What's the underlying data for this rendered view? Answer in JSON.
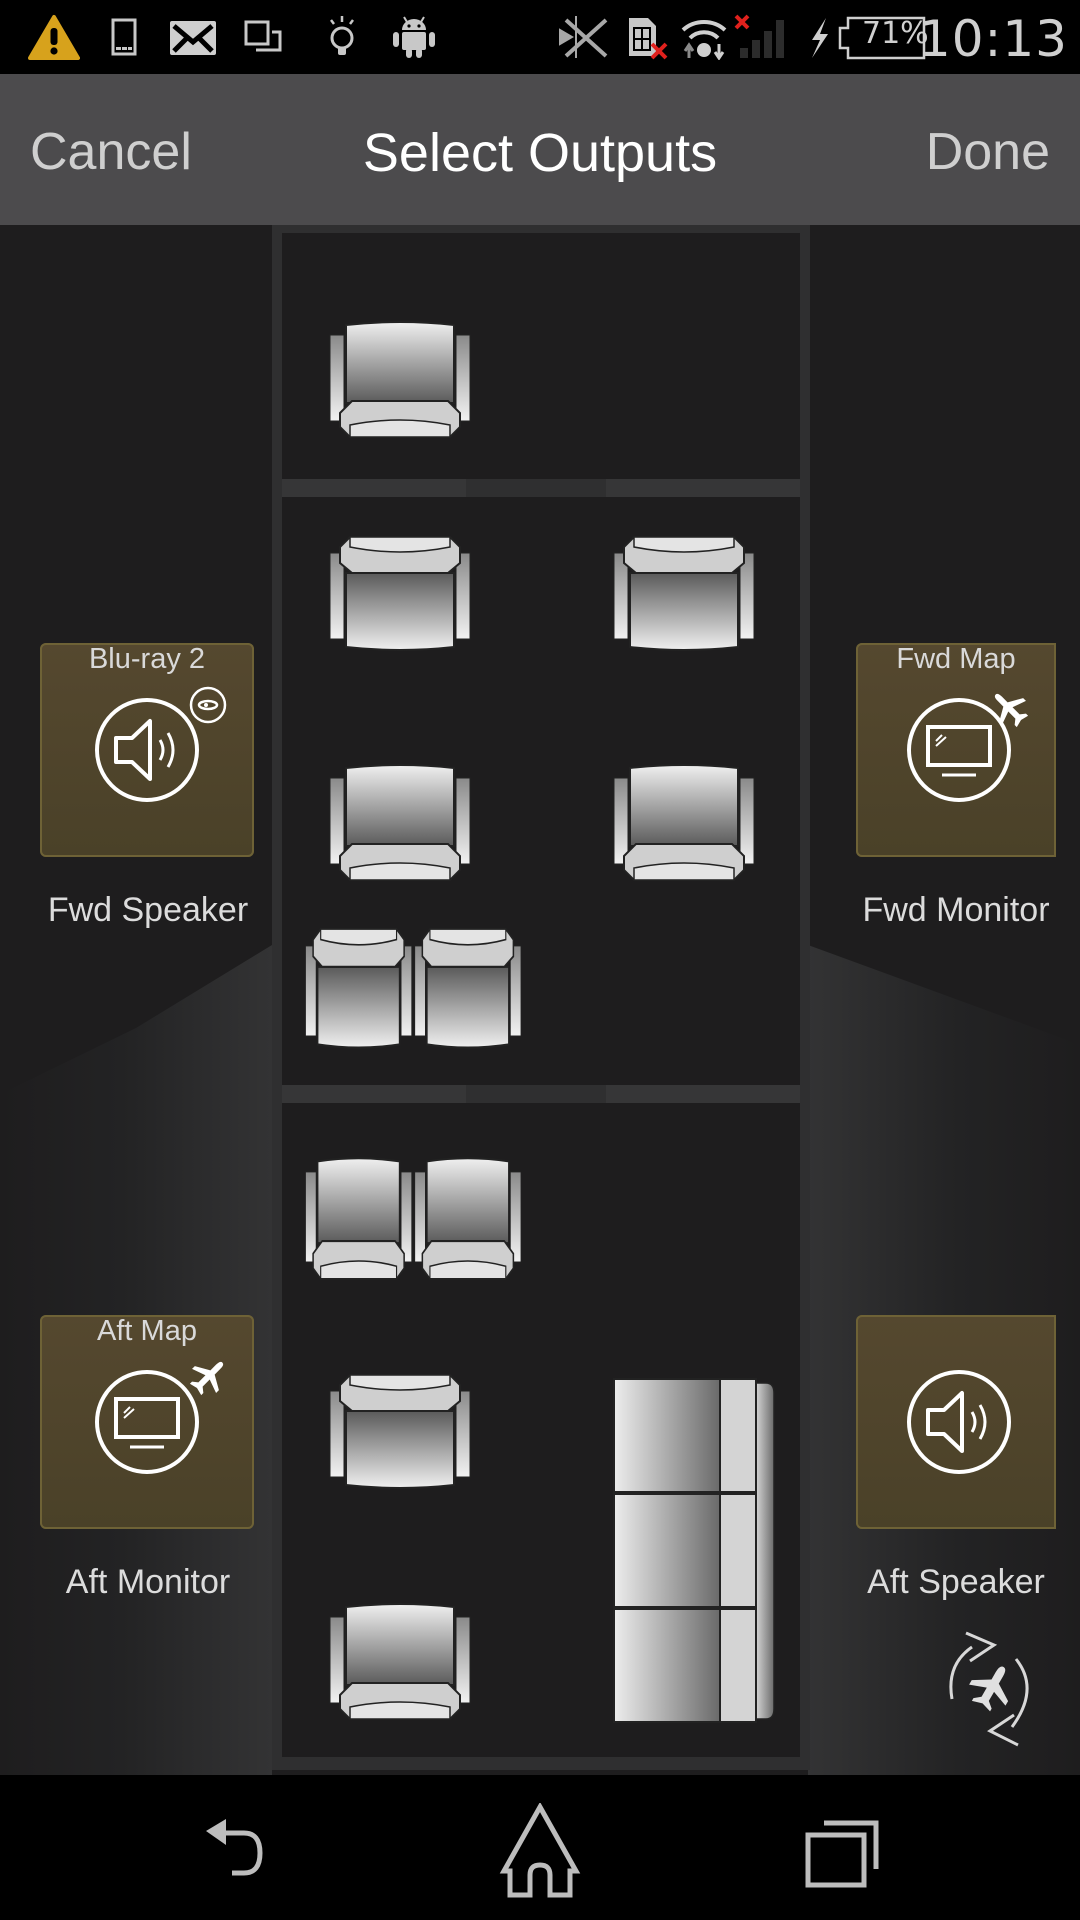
{
  "status_bar": {
    "left_icons": [
      "warning-icon",
      "phone-icon",
      "email-icon",
      "screen-mirror-icon",
      "lightbulb-icon",
      "android-icon"
    ],
    "right_icons": [
      "bluetooth-off-icon",
      "sim-missing-icon",
      "wifi-icon",
      "signal-no-service-icon",
      "charging-icon",
      "battery-icon"
    ],
    "battery": "71%",
    "time": "10:13",
    "colors": {
      "warning": "#d7a21c",
      "error_x": "#e0211d"
    }
  },
  "action_bar": {
    "cancel_label": "Cancel",
    "title": "Select Outputs",
    "done_label": "Done"
  },
  "outputs": [
    {
      "id": "fwd-speaker",
      "label": "Fwd Speaker",
      "source": "Blu-ray 2",
      "icon": "speaker-icon",
      "badge": "bluray-icon",
      "side": "left",
      "position": "forward"
    },
    {
      "id": "fwd-monitor",
      "label": "Fwd Monitor",
      "source": "Fwd Map",
      "icon": "monitor-icon",
      "badge": "airplane-icon",
      "side": "right",
      "position": "forward"
    },
    {
      "id": "aft-monitor",
      "label": "Aft Monitor",
      "source": "Aft Map",
      "icon": "monitor-icon",
      "badge": "airplane-icon",
      "side": "left",
      "position": "aft"
    },
    {
      "id": "aft-speaker",
      "label": "Aft Speaker",
      "source": "",
      "icon": "speaker-icon",
      "badge": "",
      "side": "right",
      "position": "aft"
    }
  ],
  "cabin": {
    "zones": [
      "forward",
      "club",
      "aft"
    ],
    "seats": [
      {
        "zone": "forward",
        "type": "single",
        "facing": "forward"
      },
      {
        "zone": "club",
        "type": "single",
        "facing": "aft"
      },
      {
        "zone": "club",
        "type": "single",
        "facing": "aft"
      },
      {
        "zone": "club",
        "type": "single",
        "facing": "forward"
      },
      {
        "zone": "club",
        "type": "single",
        "facing": "forward"
      },
      {
        "zone": "club",
        "type": "double",
        "facing": "aft"
      },
      {
        "zone": "club",
        "type": "double",
        "facing": "forward"
      },
      {
        "zone": "aft",
        "type": "single",
        "facing": "aft"
      },
      {
        "zone": "aft",
        "type": "single",
        "facing": "forward"
      },
      {
        "zone": "aft",
        "type": "divan",
        "facing": "side"
      }
    ]
  },
  "sync_button": {
    "icon": "sync-airplane-icon"
  },
  "nav_bar": {
    "buttons": [
      "back-icon",
      "home-icon",
      "recent-apps-icon"
    ]
  },
  "colors": {
    "tile_fill": "#4f452c",
    "tile_border": "#6e6236",
    "background": "#1e1d1e",
    "action_bar": "#4c4b4d"
  }
}
